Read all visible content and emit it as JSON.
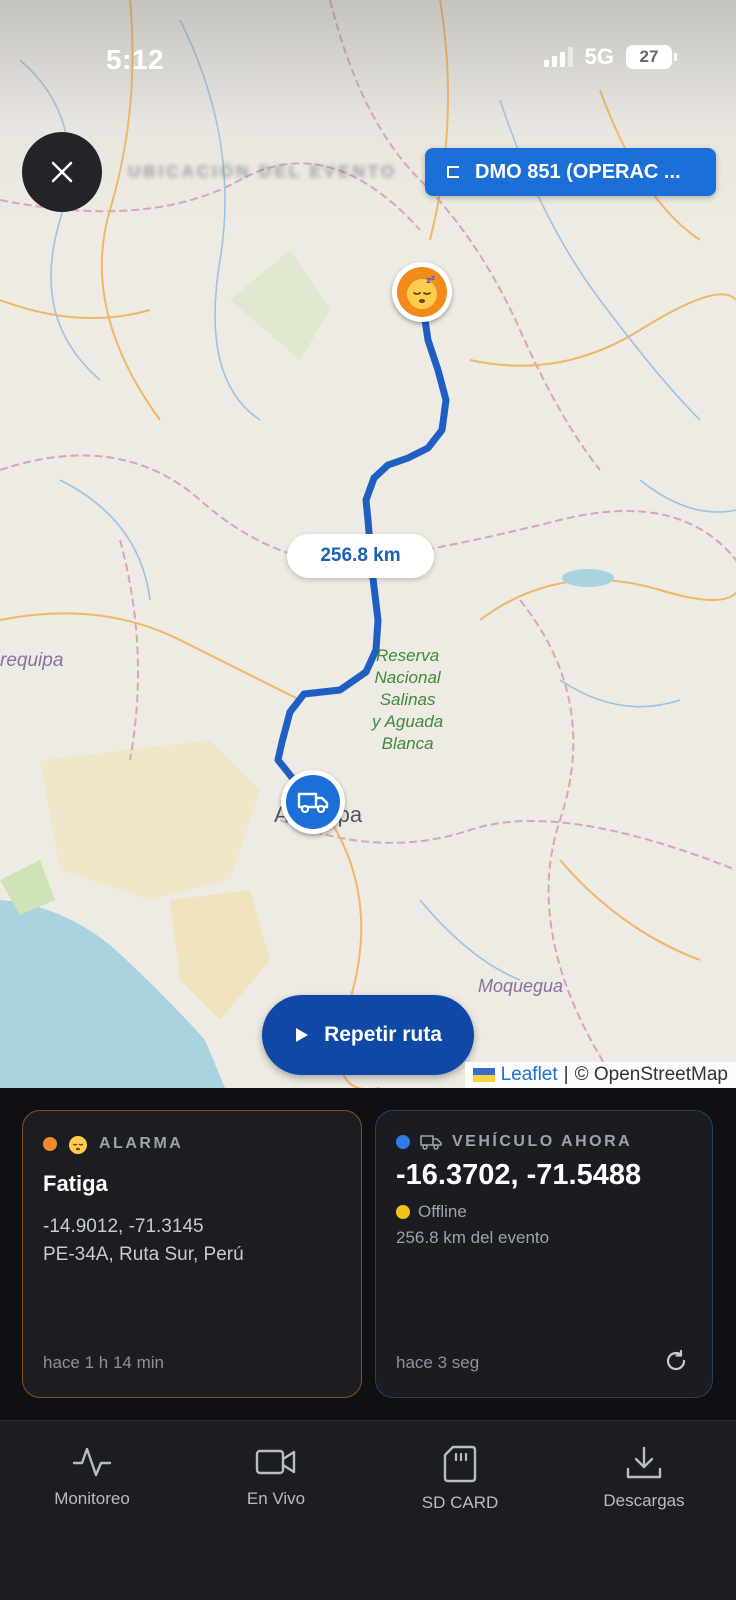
{
  "status_bar": {
    "time": "5:12",
    "network": "5G",
    "battery": "27"
  },
  "map": {
    "heading": "UBICACIÓN DEL EVENTO",
    "vehicle_chip": "DMO 851 (OPERAC ...",
    "distance_label": "256.8 km",
    "replay_button": "Repetir ruta",
    "place_labels": {
      "arequipa_left": "requipa",
      "arequipa_city": "Arequipa",
      "reserve": [
        "Reserva",
        "Nacional",
        "Salinas",
        "y Aguada",
        "Blanca"
      ],
      "moquegua": "Moquegua"
    },
    "attribution": {
      "leaflet": "Leaflet",
      "separator": "|",
      "osm": "© OpenStreetMap"
    },
    "colors": {
      "route": "#1f5fc4",
      "accent": "#1b6fd6",
      "event_marker": "#f28a1c",
      "water": "#a9d3df"
    }
  },
  "alarm_card": {
    "section_label": "ALARMA",
    "icon": "sleeping-face-icon",
    "title": "Fatiga",
    "coords": "-14.9012, -71.3145",
    "address": "PE-34A, Ruta Sur, Perú",
    "time_ago": "hace 1 h 14 min",
    "colors": {
      "dot": "#ee8a2e",
      "border": "#8a4f1f"
    }
  },
  "vehicle_card": {
    "section_label": "VEHÍCULO AHORA",
    "icon": "truck-icon",
    "coords": "-16.3702, -71.5488",
    "status": "Offline",
    "distance": "256.8 km del evento",
    "time_ago": "hace 3 seg",
    "colors": {
      "dot": "#2f7de3",
      "status_dot": "#f2c21b"
    }
  },
  "nav": {
    "items": [
      {
        "label": "Monitoreo",
        "icon": "activity-icon"
      },
      {
        "label": "En Vivo",
        "icon": "video-camera-icon"
      },
      {
        "label": "SD CARD",
        "icon": "sd-card-icon"
      },
      {
        "label": "Descargas",
        "icon": "download-icon"
      }
    ]
  }
}
